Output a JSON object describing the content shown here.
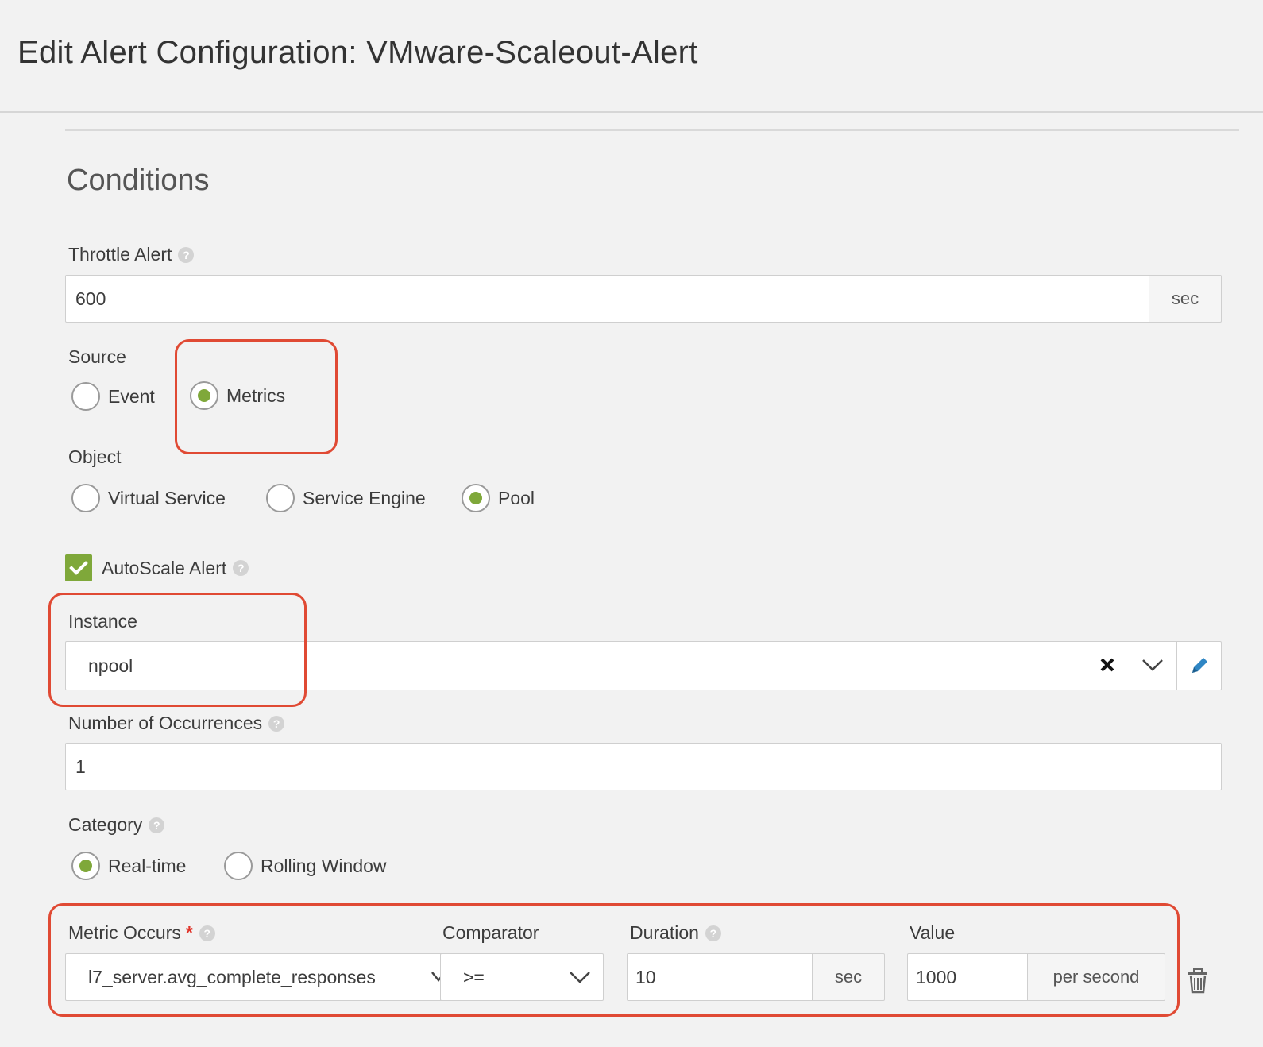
{
  "header": {
    "title": "Edit Alert Configuration: VMware-Scaleout-Alert"
  },
  "conditions": {
    "title": "Conditions",
    "throttle": {
      "label": "Throttle Alert",
      "value": "600",
      "unit": "sec"
    },
    "source": {
      "label": "Source",
      "options": [
        {
          "label": "Event",
          "selected": false
        },
        {
          "label": "Metrics",
          "selected": true
        }
      ]
    },
    "object": {
      "label": "Object",
      "options": [
        {
          "label": "Virtual Service",
          "selected": false
        },
        {
          "label": "Service Engine",
          "selected": false
        },
        {
          "label": "Pool",
          "selected": true
        }
      ]
    },
    "autoscale": {
      "label": "AutoScale Alert",
      "checked": true
    },
    "instance": {
      "label": "Instance",
      "value": "npool"
    },
    "occurrences": {
      "label": "Number of Occurrences",
      "value": "1"
    },
    "category": {
      "label": "Category",
      "options": [
        {
          "label": "Real-time",
          "selected": true
        },
        {
          "label": "Rolling Window",
          "selected": false
        }
      ]
    },
    "metric_row": {
      "metric_label": "Metric Occurs",
      "required_mark": "*",
      "metric_value": "l7_server.avg_complete_responses",
      "comparator_label": "Comparator",
      "comparator_value": ">=",
      "duration_label": "Duration",
      "duration_value": "10",
      "duration_unit": "sec",
      "value_label": "Value",
      "value_value": "1000",
      "value_unit": "per second"
    }
  },
  "colors": {
    "accent_green": "#7fa83a",
    "highlight_red": "#e04a34"
  },
  "icons": [
    "help-icon",
    "clear-icon",
    "chevron-down-icon",
    "pencil-icon",
    "trash-icon",
    "check-icon"
  ]
}
